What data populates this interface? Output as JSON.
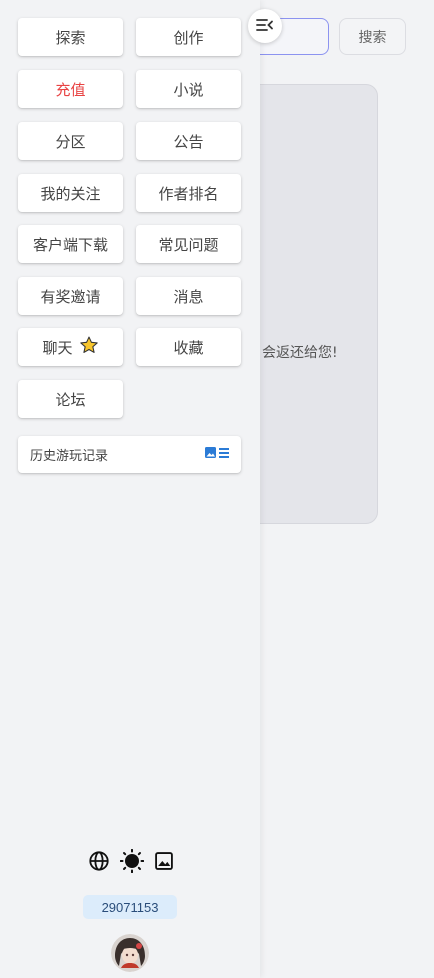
{
  "background": {
    "search_button_label": "搜索",
    "card_text": "会返还给您!"
  },
  "menu": {
    "items": [
      {
        "label": "探索",
        "name": "menu-explore"
      },
      {
        "label": "创作",
        "name": "menu-create"
      },
      {
        "label": "充值",
        "name": "menu-recharge",
        "color": "#e84343"
      },
      {
        "label": "小说",
        "name": "menu-novel"
      },
      {
        "label": "分区",
        "name": "menu-category"
      },
      {
        "label": "公告",
        "name": "menu-announcement"
      },
      {
        "label": "我的关注",
        "name": "menu-following"
      },
      {
        "label": "作者排名",
        "name": "menu-author-ranking"
      },
      {
        "label": "客户端下载",
        "name": "menu-client-download"
      },
      {
        "label": "常见问题",
        "name": "menu-faq"
      },
      {
        "label": "有奖邀请",
        "name": "menu-invite"
      },
      {
        "label": "消息",
        "name": "menu-messages"
      },
      {
        "label": "聊天",
        "name": "menu-chat",
        "icon": "star-icon"
      },
      {
        "label": "收藏",
        "name": "menu-favorites"
      },
      {
        "label": "论坛",
        "name": "menu-forum"
      }
    ],
    "history_label": "历史游玩记录",
    "history_icon": "image-list-icon"
  },
  "footer": {
    "icons": [
      "globe-icon",
      "sun-icon",
      "image-icon"
    ],
    "user_id": "29071153"
  },
  "colors": {
    "accent_red": "#e84343",
    "id_badge_bg": "#dcecfb",
    "history_icon_color": "#2b7bd6",
    "search_border": "#8c93f0"
  }
}
